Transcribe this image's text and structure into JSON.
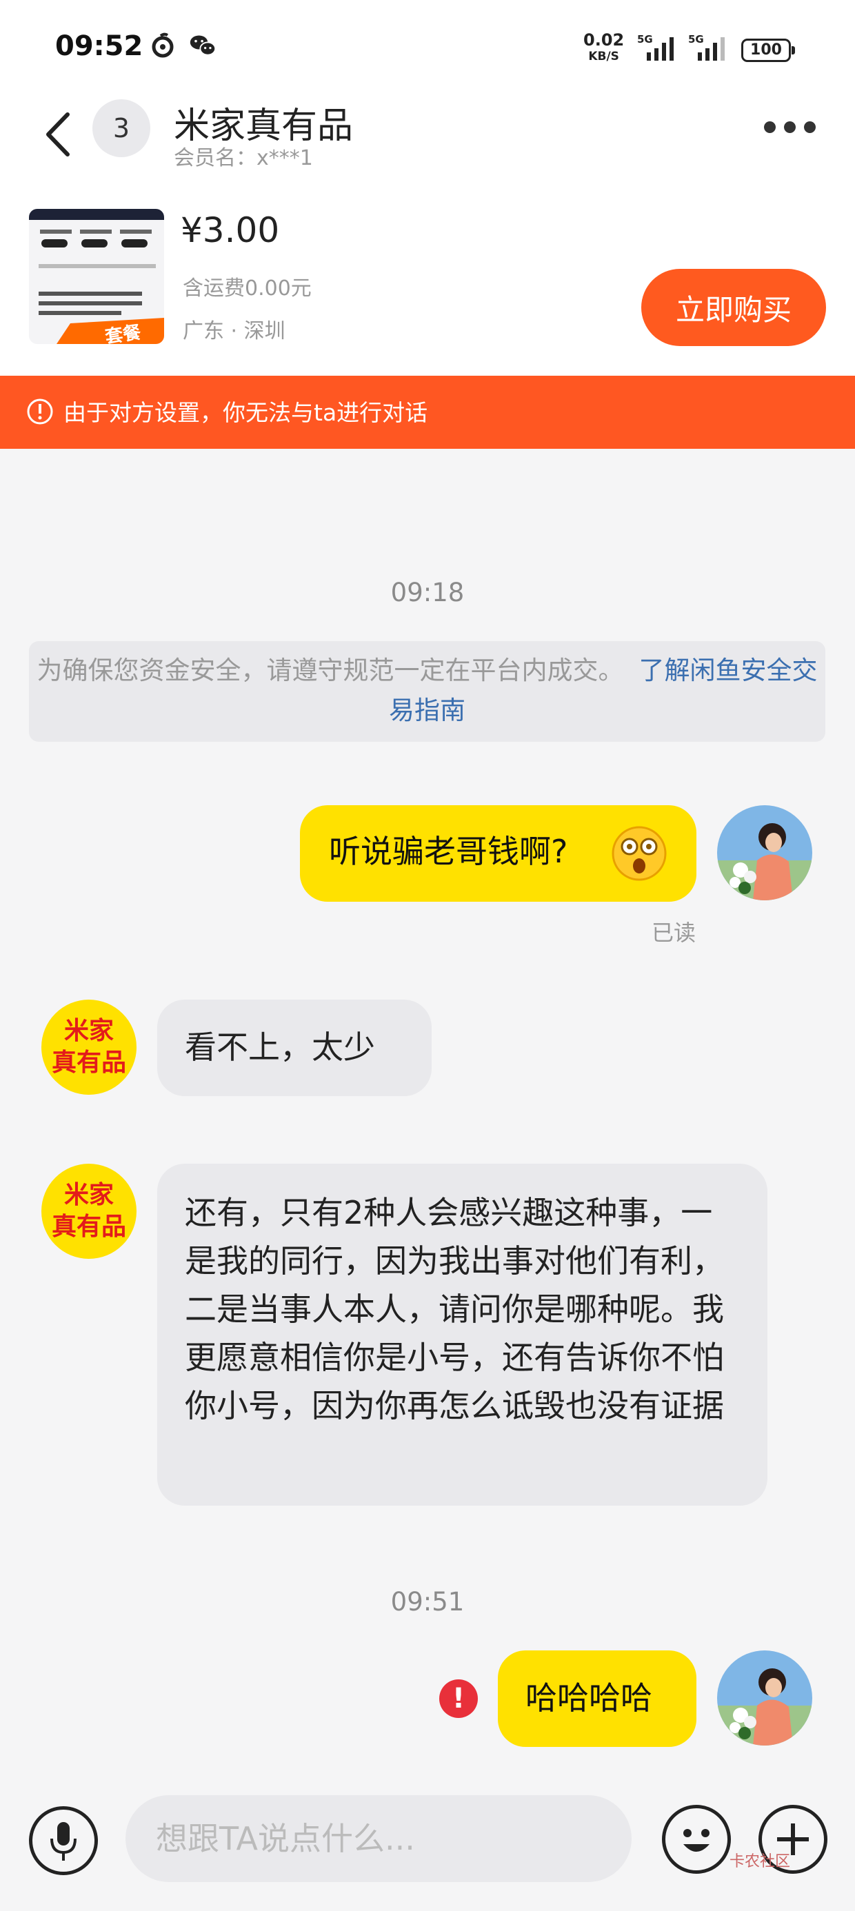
{
  "status_bar": {
    "time": "09:52",
    "net_speed": "0.02",
    "net_unit": "KB/S",
    "sig1": "5G",
    "sig2": "5G",
    "battery": "100",
    "icons": [
      "netease-music-icon",
      "wechat-icon"
    ]
  },
  "header": {
    "back_icon": "chevron-left-icon",
    "unread_count": "3",
    "title": "米家真有品",
    "member_label": "会员名：x***1",
    "more_icon": "more-horizontal-icon"
  },
  "product": {
    "price": "¥3.00",
    "shipping": "含运费0.00元",
    "location": "广东 · 深圳",
    "buy_label": "立即购买",
    "thumb_text": "套餐"
  },
  "banner": {
    "icon": "alert-circle-icon",
    "text": "由于对方设置，你无法与ta进行对话"
  },
  "chat": {
    "time1": "09:18",
    "notice_text": "为确保您资金安全，请遵守规范一定在平台内成交。",
    "notice_link": "了解闲鱼安全交易指南",
    "msg1": "听说骗老哥钱啊?",
    "msg1_read": "已读",
    "shop_avatar_line1": "米家",
    "shop_avatar_line2": "真有品",
    "msg2": "看不上，太少",
    "msg3": "还有，只有2种人会感兴趣这种事，一是我的同行，因为我出事对他们有利，二是当事人本人，请问你是哪种呢。我更愿意相信你是小号，还有告诉你不怕你小号，因为你再怎么诋毁也没有证据",
    "time2": "09:51",
    "msg4": "哈哈哈哈",
    "error_mark": "!"
  },
  "input_bar": {
    "voice_icon": "microphone-icon",
    "placeholder": "想跟TA说点什么...",
    "emoji_icon": "smiley-icon",
    "plus_icon": "plus-icon",
    "watermark": "卡农社区"
  },
  "colors": {
    "accent_orange": "#ff5722",
    "buy_button": "#ff5a1f",
    "my_bubble": "#ffe100",
    "their_bubble": "#e9e9ec",
    "error_red": "#e8303a"
  }
}
